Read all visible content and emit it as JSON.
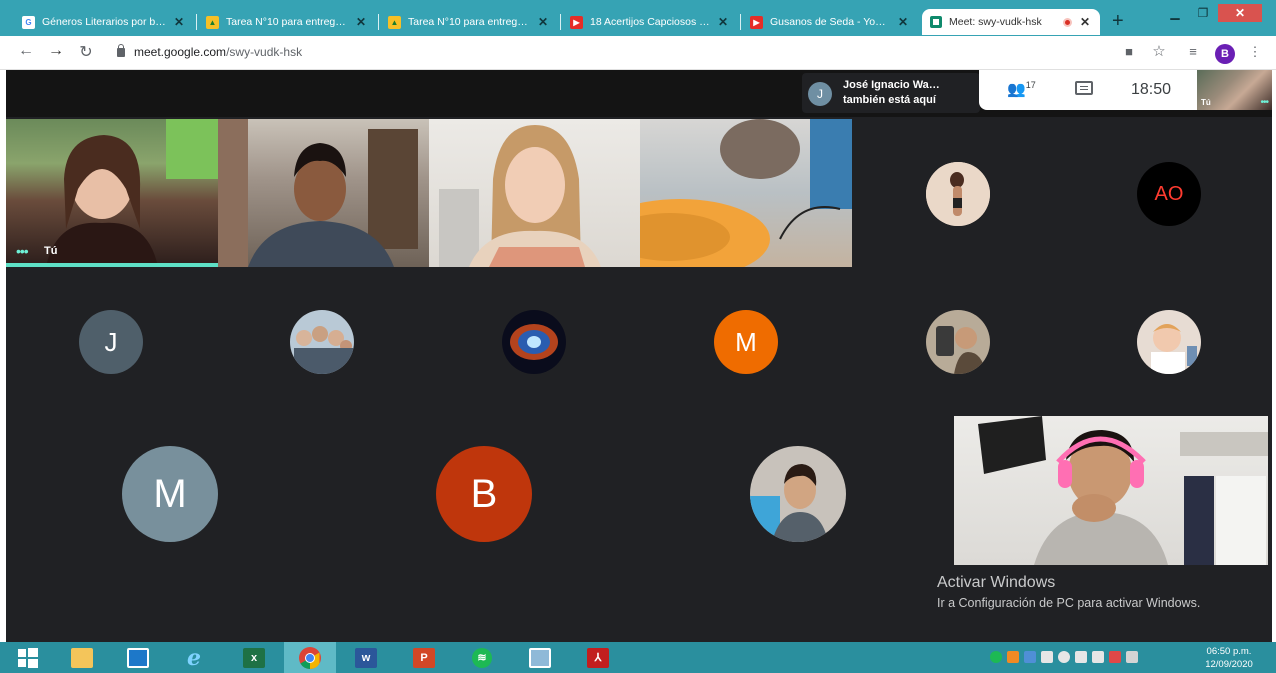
{
  "browser": {
    "tabs": [
      {
        "title": "Géneros Literarios por b…",
        "icon": "google-icon",
        "active": false
      },
      {
        "title": "Tarea N°10 para entrega…",
        "icon": "classroom-icon",
        "active": false
      },
      {
        "title": "Tarea N°10 para entrega…",
        "icon": "classroom-icon",
        "active": false
      },
      {
        "title": "18 Acertijos Capciosos Q…",
        "icon": "youtube-icon",
        "active": false
      },
      {
        "title": "Gusanos de Seda - YouT…",
        "icon": "youtube-icon",
        "active": false
      },
      {
        "title": "Meet: swy-vudk-hsk",
        "icon": "meet-icon",
        "active": true,
        "recording": true
      }
    ],
    "url_domain": "meet.google.com",
    "url_path": "/swy-vudk-hsk",
    "profile_initial": "B"
  },
  "meet": {
    "join_notice": {
      "initial": "J",
      "name": "José Ignacio Wa…",
      "text": "también está aquí"
    },
    "participants_count": "17",
    "time": "18:50",
    "self_label": "Tú",
    "video_tiles": [
      {
        "label": "Tú",
        "speaking": true
      },
      {
        "label": ""
      },
      {
        "label": ""
      },
      {
        "label": ""
      }
    ],
    "avatars": [
      {
        "kind": "photo",
        "icon": "woman-standing-photo"
      },
      {
        "kind": "initials",
        "text": "AO",
        "color": "#000000"
      },
      {
        "kind": "initials",
        "text": "J",
        "color": "#4f5f6a"
      },
      {
        "kind": "photo",
        "icon": "group-photo"
      },
      {
        "kind": "photo",
        "icon": "nebula-photo"
      },
      {
        "kind": "initials",
        "text": "M",
        "color": "#ef6c00"
      },
      {
        "kind": "photo",
        "icon": "man-selfie-photo"
      },
      {
        "kind": "photo",
        "icon": "baby-photo"
      },
      {
        "kind": "initials",
        "text": "M",
        "color": "#78909c"
      },
      {
        "kind": "initials",
        "text": "B",
        "color": "#bf360c"
      },
      {
        "kind": "photo",
        "icon": "boy-photo"
      }
    ],
    "presenter_tile": {
      "label": ""
    }
  },
  "windows_watermark": {
    "title": "Activar Windows",
    "subtitle": "Ir a Configuración de PC para activar Windows."
  },
  "taskbar": {
    "apps": [
      {
        "name": "start-icon"
      },
      {
        "name": "file-explorer-icon"
      },
      {
        "name": "remote-desktop-icon"
      },
      {
        "name": "internet-explorer-icon"
      },
      {
        "name": "excel-icon"
      },
      {
        "name": "chrome-icon",
        "active": true
      },
      {
        "name": "word-icon"
      },
      {
        "name": "powerpoint-icon"
      },
      {
        "name": "spotify-icon"
      },
      {
        "name": "photos-icon"
      },
      {
        "name": "acrobat-icon"
      }
    ],
    "clock_time": "06:50 p.m.",
    "clock_date": "12/09/2020"
  }
}
